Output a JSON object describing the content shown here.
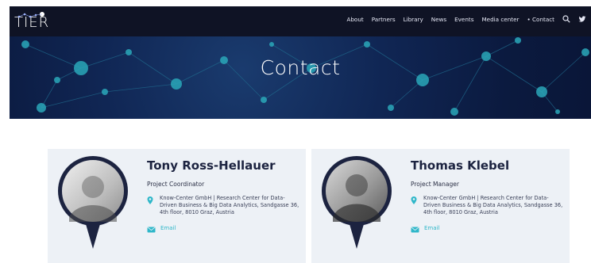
{
  "header": {
    "logo_text": "TIER",
    "nav": [
      "About",
      "Partners",
      "Library",
      "News",
      "Events",
      "Media center",
      "Contact"
    ],
    "icons": [
      "search-icon",
      "twitter-icon"
    ]
  },
  "hero": {
    "title": "Contact"
  },
  "contacts": [
    {
      "name": "Tony Ross-Hellauer",
      "role": "Project Coordinator",
      "address": "Know-Center GmbH | Research Center for Data-Driven Business & Big Data Analytics, Sandgasse 36, 4th floor, 8010 Graz, Austria",
      "email_label": "Email"
    },
    {
      "name": "Thomas Klebel",
      "role": "Project Manager",
      "address": "Know-Center GmbH | Research Center for Data-Driven Business & Big Data Analytics, Sandgasse 36, 4th floor, 8010 Graz, Austria",
      "email_label": "Email"
    }
  ],
  "colors": {
    "nav_bg": "#0f1325",
    "hero_bg": "#0b1a3f",
    "accent": "#2fb7c9",
    "card_bg": "#edf1f6",
    "pin": "#1c2340"
  }
}
